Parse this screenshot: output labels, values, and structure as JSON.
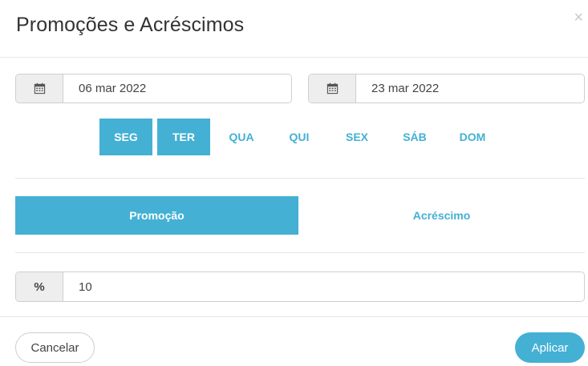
{
  "modal": {
    "title": "Promoções e Acréscimos",
    "close_label": "×"
  },
  "dates": {
    "start": "06 mar 2022",
    "end": "23 mar 2022",
    "icon": "calendar-icon"
  },
  "weekdays": [
    {
      "label": "SEG",
      "selected": true
    },
    {
      "label": "TER",
      "selected": true
    },
    {
      "label": "QUA",
      "selected": false
    },
    {
      "label": "QUI",
      "selected": false
    },
    {
      "label": "SEX",
      "selected": false
    },
    {
      "label": "SÁB",
      "selected": false
    },
    {
      "label": "DOM",
      "selected": false
    }
  ],
  "mode": {
    "promotion_label": "Promoção",
    "surcharge_label": "Acréscimo",
    "selected": "Promoção"
  },
  "percent": {
    "symbol": "%",
    "value": "10"
  },
  "footer": {
    "cancel_label": "Cancelar",
    "apply_label": "Aplicar"
  },
  "colors": {
    "accent": "#44b0d4",
    "addon_bg": "#eeeeee",
    "border": "#cfcfcf"
  }
}
